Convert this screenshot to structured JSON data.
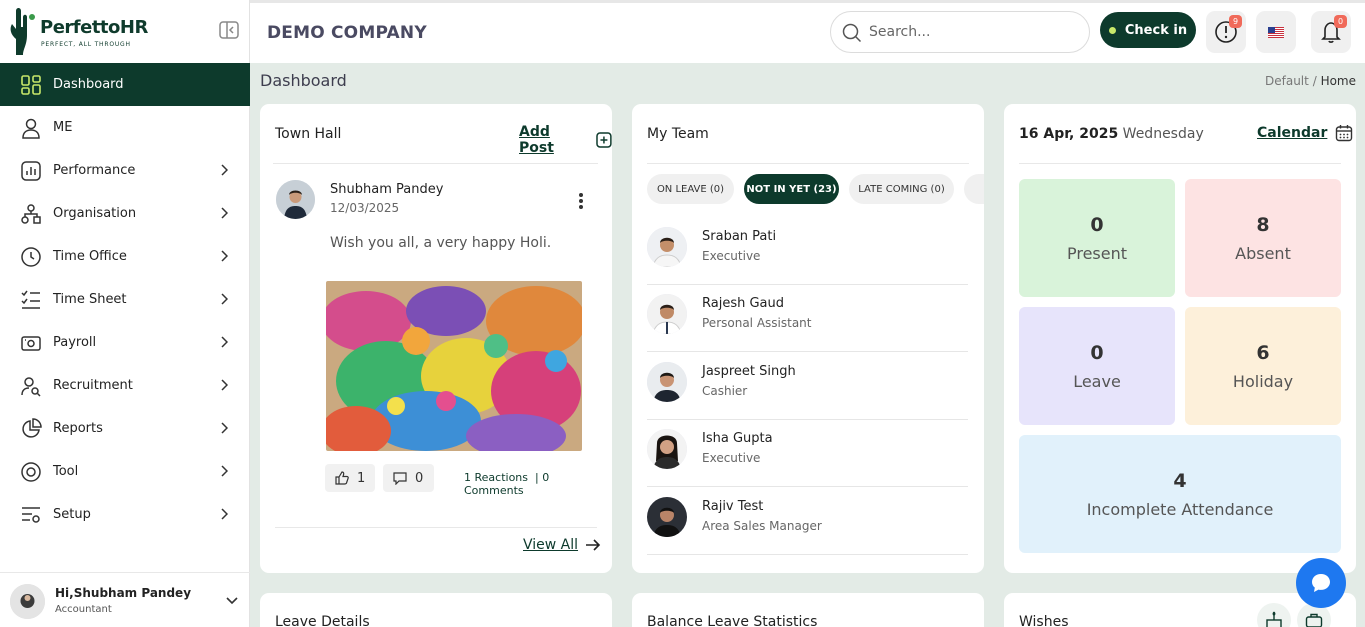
{
  "brand": {
    "name": "PerfettoHR",
    "tagline": "PERFECT, ALL THROUGH"
  },
  "header": {
    "company": "DEMO COMPANY",
    "search_placeholder": "Search...",
    "checkin_label": "Check in",
    "alerts_badge": "9",
    "notifications_badge": "0"
  },
  "sidebar": {
    "items": [
      {
        "label": "Dashboard",
        "icon": "grid-icon"
      },
      {
        "label": "ME",
        "icon": "user-icon"
      },
      {
        "label": "Performance",
        "icon": "chart-icon"
      },
      {
        "label": "Organisation",
        "icon": "org-icon"
      },
      {
        "label": "Time Office",
        "icon": "clock-icon"
      },
      {
        "label": "Time Sheet",
        "icon": "checklist-icon"
      },
      {
        "label": "Payroll",
        "icon": "payroll-icon"
      },
      {
        "label": "Recruitment",
        "icon": "recruit-icon"
      },
      {
        "label": "Reports",
        "icon": "pie-icon"
      },
      {
        "label": "Tool",
        "icon": "tool-icon"
      },
      {
        "label": "Setup",
        "icon": "setup-icon"
      }
    ],
    "user": {
      "greeting": "Hi,Shubham Pandey",
      "role": "Accountant"
    }
  },
  "page": {
    "title": "Dashboard",
    "breadcrumb_root": "Default",
    "breadcrumb_sep": "/",
    "breadcrumb_current": "Home"
  },
  "townhall": {
    "title": "Town Hall",
    "add_post": "Add Post",
    "author": "Shubham Pandey",
    "date": "12/03/2025",
    "text": "Wish you all, a very happy Holi.",
    "likes": "1",
    "comments": "0",
    "reactions_text": "1 Reactions",
    "comments_text": "| 0 Comments",
    "view_all": "View All"
  },
  "team": {
    "title": "My Team",
    "pills": [
      "ON LEAVE (0)",
      "NOT IN YET (23)",
      "LATE COMING (0)"
    ],
    "members": [
      {
        "name": "Sraban Pati",
        "role": "Executive"
      },
      {
        "name": "Rajesh Gaud",
        "role": "Personal Assistant"
      },
      {
        "name": "Jaspreet Singh",
        "role": "Cashier"
      },
      {
        "name": "Isha Gupta",
        "role": "Executive"
      },
      {
        "name": "Rajiv Test",
        "role": "Area Sales Manager"
      }
    ]
  },
  "calendar": {
    "date": "16 Apr, 2025",
    "weekday": "Wednesday",
    "link": "Calendar",
    "tiles": [
      {
        "num": "0",
        "label": "Present",
        "bg": "#d9f3da"
      },
      {
        "num": "8",
        "label": "Absent",
        "bg": "#fde3e3"
      },
      {
        "num": "0",
        "label": "Leave",
        "bg": "#e7e4fb"
      },
      {
        "num": "6",
        "label": "Holiday",
        "bg": "#fdf0da"
      },
      {
        "num": "4",
        "label": "Incomplete Attendance",
        "bg": "#e1f1fb"
      }
    ]
  },
  "bottom": {
    "leave_details": "Leave Details",
    "balance_leave": "Balance Leave Statistics",
    "wishes": "Wishes"
  },
  "colors": {
    "primary": "#0d3a2c",
    "accent": "#1e78f0",
    "badge": "#f06a5a"
  }
}
